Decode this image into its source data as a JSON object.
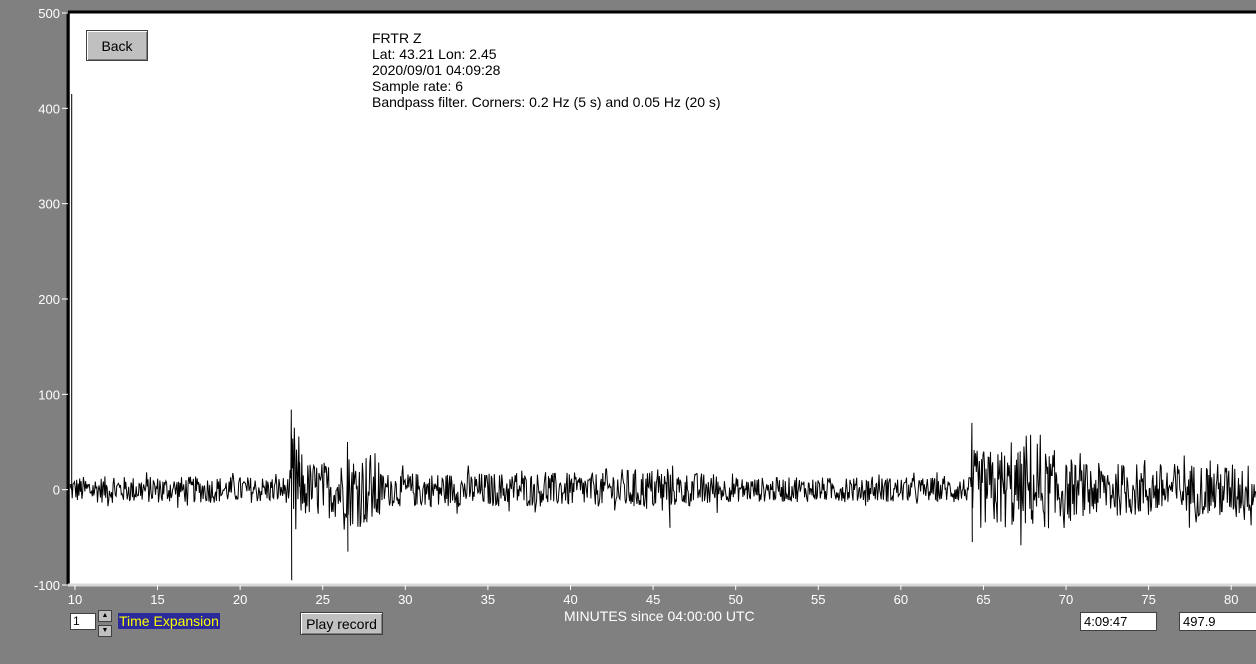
{
  "station_info": {
    "station": "FRTR  Z",
    "location": "Lat: 43.21 Lon: 2.45",
    "datetime": "2020/09/01 04:09:28",
    "sample_rate": "Sample rate: 6",
    "filter": "Bandpass filter. Corners: 0.2 Hz (5 s) and 0.05 Hz (20 s)"
  },
  "controls": {
    "back_label": "Back",
    "time_expansion_value": "1",
    "time_expansion_label": "Time Expansion",
    "play_label": "Play record",
    "cursor_time": "4:09:47",
    "cursor_value": "497.9"
  },
  "colors": {
    "background": "#808080",
    "plot_background": "#ffffff",
    "trace": "#000000",
    "time_expansion_text": "#ffff00",
    "time_expansion_bg": "#2a2a9a"
  },
  "chart_data": {
    "type": "line",
    "xlabel": "MINUTES since 04:00:00 UTC",
    "ylabel": "",
    "xlim": [
      9.7,
      81.5
    ],
    "ylim": [
      -100,
      500
    ],
    "x_ticks": [
      10,
      15,
      20,
      25,
      30,
      35,
      40,
      45,
      50,
      55,
      60,
      65,
      70,
      75,
      80
    ],
    "y_ticks": [
      -100,
      0,
      100,
      200,
      300,
      400,
      500
    ],
    "grid": false,
    "series": [
      {
        "segments": [
          {
            "x": [
              9.7,
              23.1
            ],
            "amplitude": 14
          },
          {
            "x": [
              23.1,
              23.6
            ],
            "amplitude": 70,
            "peak_max": 84,
            "peak_min": -95
          },
          {
            "x": [
              23.6,
              26.5
            ],
            "amplitude": 30
          },
          {
            "x": [
              26.5,
              28.5
            ],
            "amplitude": 40,
            "peak_max": 50,
            "peak_min": -65
          },
          {
            "x": [
              28.5,
              42.0
            ],
            "amplitude": 18
          },
          {
            "x": [
              42.0,
              46.0
            ],
            "amplitude": 22
          },
          {
            "x": [
              46.0,
              49.0
            ],
            "amplitude": 18,
            "peak_min": -40
          },
          {
            "x": [
              49.0,
              64.3
            ],
            "amplitude": 13
          },
          {
            "x": [
              64.3,
              70.0
            ],
            "amplitude": 42,
            "peak_max": 70,
            "peak_min": -55
          },
          {
            "x": [
              70.0,
              81.5
            ],
            "amplitude": 28
          }
        ],
        "initial_spike": {
          "x": 9.8,
          "max": 415
        }
      }
    ]
  }
}
